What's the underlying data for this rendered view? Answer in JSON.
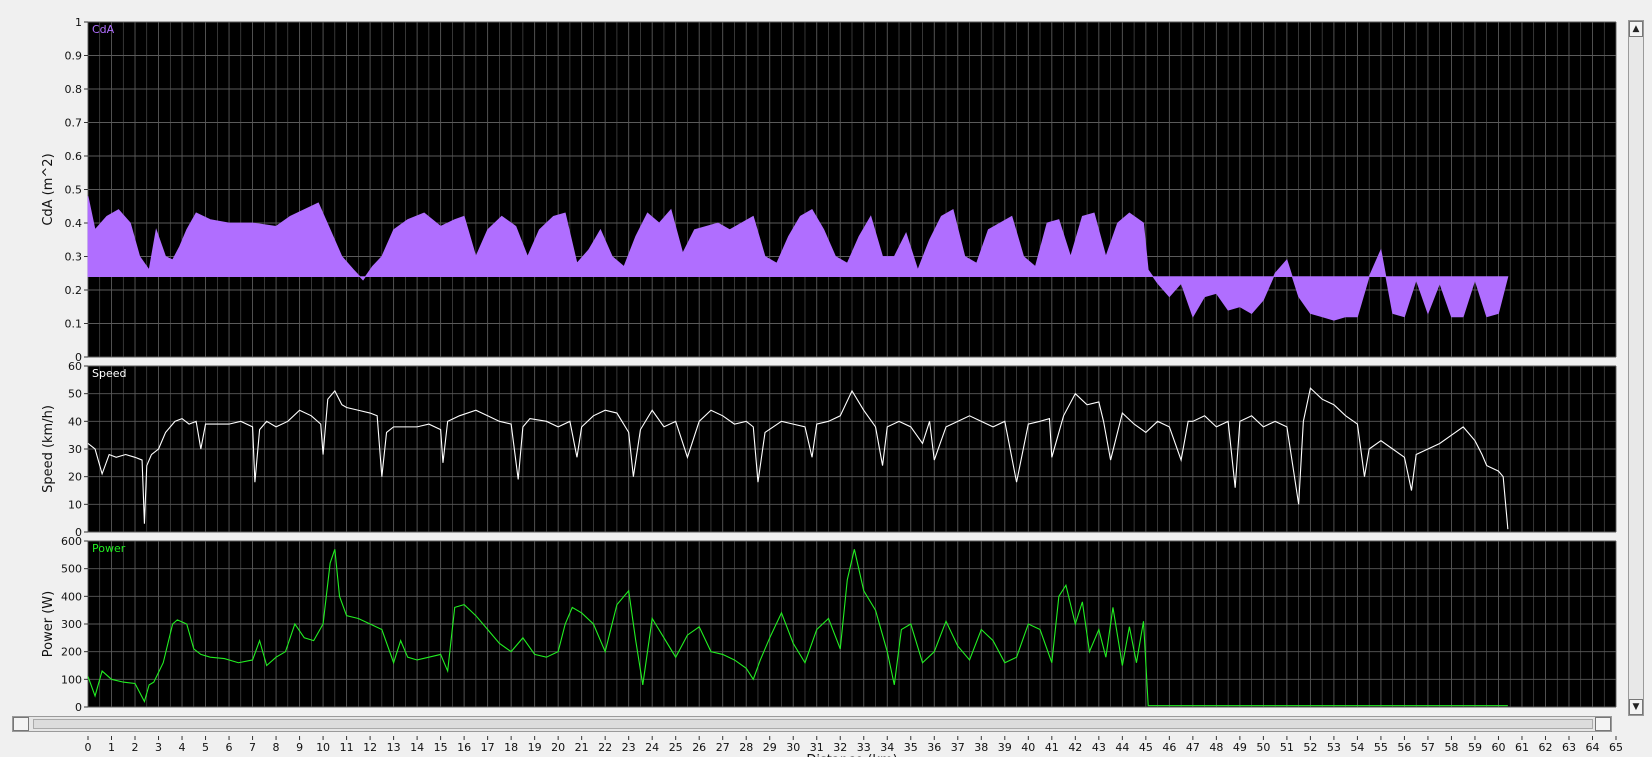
{
  "chart_data": [
    {
      "type": "area",
      "title": "CdA",
      "ylabel": "CdA (m^2)",
      "xlabel": "Distance (km)",
      "ylim": [
        0,
        1
      ],
      "yticks": [
        "0",
        "0.1",
        "0.2",
        "0.3",
        "0.4",
        "0.5",
        "0.6",
        "0.7",
        "0.8",
        "0.9",
        "1"
      ],
      "baseline": 0.24,
      "series": [
        {
          "name": "CdA",
          "color": "#b06eff",
          "x": [
            0,
            0.3,
            0.8,
            1.3,
            1.8,
            2.2,
            2.6,
            2.9,
            3.3,
            3.6,
            3.9,
            4.2,
            4.6,
            5.2,
            6,
            7,
            8,
            8.6,
            9.2,
            9.8,
            10.3,
            10.8,
            11.3,
            11.7,
            12.1,
            12.5,
            13,
            13.6,
            14.3,
            15,
            15.6,
            16,
            16.5,
            17,
            17.6,
            18.2,
            18.7,
            19.2,
            19.8,
            20.3,
            20.8,
            21.3,
            21.8,
            22.3,
            22.8,
            23.3,
            23.8,
            24.3,
            24.8,
            25.3,
            25.8,
            26.3,
            26.8,
            27.3,
            27.8,
            28.3,
            28.8,
            29.3,
            29.8,
            30.3,
            30.8,
            31.3,
            31.8,
            32.3,
            32.8,
            33.3,
            33.8,
            34.3,
            34.8,
            35.3,
            35.8,
            36.3,
            36.8,
            37.3,
            37.8,
            38.3,
            38.8,
            39.3,
            39.8,
            40.3,
            40.8,
            41.3,
            41.8,
            42.3,
            42.8,
            43.3,
            43.8,
            44.3,
            44.9,
            45.1,
            45.5,
            46,
            46.5,
            47,
            47.5,
            48,
            48.5,
            49,
            49.5,
            50,
            50.5,
            51,
            51.5,
            52,
            52.5,
            53,
            53.5,
            54,
            54.5,
            55,
            55.5,
            56,
            56.5,
            57,
            57.5,
            58,
            58.5,
            59,
            59.5,
            60,
            60.4
          ],
          "values": [
            0.48,
            0.38,
            0.42,
            0.44,
            0.4,
            0.3,
            0.26,
            0.38,
            0.3,
            0.29,
            0.33,
            0.38,
            0.43,
            0.41,
            0.4,
            0.4,
            0.39,
            0.42,
            0.44,
            0.46,
            0.38,
            0.3,
            0.26,
            0.23,
            0.27,
            0.3,
            0.38,
            0.41,
            0.43,
            0.39,
            0.41,
            0.42,
            0.3,
            0.38,
            0.42,
            0.39,
            0.3,
            0.38,
            0.42,
            0.43,
            0.28,
            0.32,
            0.38,
            0.3,
            0.27,
            0.36,
            0.43,
            0.4,
            0.44,
            0.31,
            0.38,
            0.39,
            0.4,
            0.38,
            0.4,
            0.42,
            0.3,
            0.28,
            0.36,
            0.42,
            0.44,
            0.38,
            0.3,
            0.28,
            0.36,
            0.42,
            0.3,
            0.3,
            0.37,
            0.26,
            0.35,
            0.42,
            0.44,
            0.3,
            0.28,
            0.38,
            0.4,
            0.42,
            0.3,
            0.27,
            0.4,
            0.41,
            0.3,
            0.42,
            0.43,
            0.3,
            0.4,
            0.43,
            0.4,
            0.26,
            0.22,
            0.18,
            0.22,
            0.12,
            0.18,
            0.19,
            0.14,
            0.15,
            0.13,
            0.17,
            0.25,
            0.29,
            0.18,
            0.13,
            0.12,
            0.11,
            0.12,
            0.12,
            0.24,
            0.32,
            0.13,
            0.12,
            0.23,
            0.13,
            0.22,
            0.12,
            0.12,
            0.23,
            0.12,
            0.13,
            0.24
          ]
        }
      ],
      "grid": true,
      "background": "#000000"
    },
    {
      "type": "line",
      "title": "Speed",
      "ylabel": "Speed (km/h)",
      "xlabel": "Distance (km)",
      "ylim": [
        0,
        60
      ],
      "yticks": [
        "0",
        "10",
        "20",
        "30",
        "40",
        "50",
        "60"
      ],
      "series": [
        {
          "name": "Speed",
          "color": "#ffffff",
          "x": [
            0,
            0.3,
            0.6,
            0.9,
            1.2,
            1.6,
            2,
            2.3,
            2.4,
            2.5,
            2.7,
            3,
            3.3,
            3.7,
            4,
            4.3,
            4.6,
            4.8,
            5,
            5.4,
            6,
            6.5,
            7,
            7.1,
            7.3,
            7.6,
            8,
            8.5,
            9,
            9.5,
            9.9,
            10,
            10.2,
            10.5,
            10.8,
            11,
            11.5,
            12,
            12.3,
            12.5,
            12.7,
            13,
            13.5,
            14,
            14.5,
            15,
            15.1,
            15.3,
            15.8,
            16.5,
            17,
            17.5,
            18,
            18.3,
            18.5,
            18.8,
            19.5,
            20,
            20.5,
            20.8,
            21,
            21.5,
            22,
            22.5,
            23,
            23.2,
            23.5,
            24,
            24.5,
            25,
            25.5,
            26,
            26.5,
            27,
            27.5,
            28,
            28.3,
            28.5,
            28.8,
            29.5,
            30,
            30.5,
            30.8,
            31,
            31.5,
            32,
            32.5,
            33,
            33.5,
            33.8,
            34,
            34.5,
            35,
            35.5,
            35.8,
            36,
            36.5,
            37,
            37.5,
            38,
            38.5,
            39,
            39.5,
            40,
            40.5,
            40.9,
            41,
            41.5,
            42,
            42.5,
            43,
            43.2,
            43.5,
            44,
            44.5,
            45,
            45.5,
            46,
            46.5,
            46.8,
            47,
            47.5,
            48,
            48.5,
            48.8,
            49,
            49.5,
            50,
            50.5,
            51,
            51.5,
            51.7,
            52,
            52.5,
            53,
            53.5,
            54,
            54.3,
            54.5,
            55,
            55.5,
            56,
            56.3,
            56.5,
            57,
            57.5,
            58,
            58.5,
            59,
            59.3,
            59.5,
            60,
            60.2,
            60.4
          ],
          "values": [
            32,
            30,
            21,
            28,
            27,
            28,
            27,
            26,
            3,
            24,
            28,
            30,
            36,
            40,
            41,
            39,
            40,
            30,
            39,
            39,
            39,
            40,
            38,
            18,
            37,
            40,
            38,
            40,
            44,
            42,
            39,
            28,
            48,
            51,
            46,
            45,
            44,
            43,
            42,
            20,
            36,
            38,
            38,
            38,
            39,
            37,
            25,
            40,
            42,
            44,
            42,
            40,
            39,
            19,
            38,
            41,
            40,
            38,
            40,
            27,
            38,
            42,
            44,
            43,
            36,
            20,
            37,
            44,
            38,
            40,
            27,
            40,
            44,
            42,
            39,
            40,
            38,
            18,
            36,
            40,
            39,
            38,
            27,
            39,
            40,
            42,
            51,
            44,
            38,
            24,
            38,
            40,
            38,
            32,
            40,
            26,
            38,
            40,
            42,
            40,
            38,
            40,
            18,
            39,
            40,
            41,
            27,
            42,
            50,
            46,
            47,
            40,
            26,
            43,
            39,
            36,
            40,
            38,
            26,
            40,
            40,
            42,
            38,
            40,
            16,
            40,
            42,
            38,
            40,
            38,
            10,
            40,
            52,
            48,
            46,
            42,
            39,
            20,
            30,
            33,
            30,
            27,
            15,
            28,
            30,
            32,
            35,
            38,
            33,
            28,
            24,
            22,
            20,
            1
          ]
        }
      ],
      "grid": true,
      "background": "#000000"
    },
    {
      "type": "line",
      "title": "Power",
      "ylabel": "Power (W)",
      "xlabel": "Distance (km)",
      "ylim": [
        0,
        600
      ],
      "yticks": [
        "0",
        "100",
        "200",
        "300",
        "400",
        "500",
        "600"
      ],
      "series": [
        {
          "name": "Power",
          "color": "#22ee22",
          "x": [
            0,
            0.3,
            0.6,
            1,
            1.5,
            2,
            2.4,
            2.6,
            2.8,
            3.2,
            3.6,
            3.8,
            4.2,
            4.5,
            4.8,
            5.2,
            5.8,
            6.4,
            7,
            7.3,
            7.6,
            8,
            8.4,
            8.8,
            9.2,
            9.6,
            10,
            10.3,
            10.5,
            10.7,
            11,
            11.5,
            12,
            12.5,
            13,
            13.3,
            13.6,
            14,
            14.5,
            15,
            15.3,
            15.6,
            16,
            16.5,
            17,
            17.5,
            18,
            18.5,
            19,
            19.5,
            20,
            20.3,
            20.6,
            21,
            21.5,
            22,
            22.5,
            23,
            23.3,
            23.6,
            24,
            24.5,
            25,
            25.5,
            26,
            26.5,
            27,
            27.5,
            28,
            28.3,
            28.6,
            29,
            29.5,
            30,
            30.5,
            31,
            31.5,
            32,
            32.3,
            32.6,
            33,
            33.5,
            34,
            34.3,
            34.6,
            35,
            35.5,
            36,
            36.5,
            37,
            37.5,
            38,
            38.5,
            39,
            39.5,
            40,
            40.5,
            41,
            41.3,
            41.6,
            42,
            42.3,
            42.6,
            43,
            43.3,
            43.6,
            44,
            44.3,
            44.6,
            44.9,
            45.1,
            46,
            48,
            50,
            52,
            54,
            56,
            58,
            60,
            60.4
          ],
          "values": [
            110,
            40,
            130,
            100,
            90,
            85,
            20,
            80,
            90,
            160,
            300,
            315,
            300,
            210,
            190,
            180,
            175,
            160,
            170,
            240,
            150,
            180,
            200,
            300,
            250,
            240,
            300,
            520,
            570,
            400,
            330,
            320,
            300,
            280,
            160,
            240,
            180,
            170,
            180,
            190,
            130,
            360,
            370,
            330,
            280,
            230,
            200,
            250,
            190,
            180,
            200,
            300,
            360,
            340,
            300,
            200,
            370,
            420,
            240,
            80,
            320,
            250,
            180,
            260,
            290,
            200,
            190,
            170,
            140,
            100,
            170,
            250,
            340,
            230,
            160,
            280,
            320,
            210,
            460,
            570,
            420,
            350,
            200,
            80,
            280,
            300,
            160,
            200,
            310,
            220,
            170,
            280,
            240,
            160,
            180,
            300,
            280,
            160,
            400,
            440,
            300,
            380,
            200,
            280,
            180,
            360,
            150,
            290,
            160,
            310,
            5,
            5,
            5,
            5,
            5,
            5,
            5,
            5,
            5,
            5
          ]
        }
      ],
      "grid": true,
      "background": "#000000"
    }
  ],
  "x_axis": {
    "label": "Distance (km)",
    "min": 0,
    "max": 65,
    "ticks": [
      "0",
      "1",
      "2",
      "3",
      "4",
      "5",
      "6",
      "7",
      "8",
      "9",
      "10",
      "11",
      "12",
      "13",
      "14",
      "15",
      "16",
      "17",
      "18",
      "19",
      "20",
      "21",
      "22",
      "23",
      "24",
      "25",
      "26",
      "27",
      "28",
      "29",
      "30",
      "31",
      "32",
      "33",
      "34",
      "35",
      "36",
      "37",
      "38",
      "39",
      "40",
      "41",
      "42",
      "43",
      "44",
      "45",
      "46",
      "47",
      "48",
      "49",
      "50",
      "51",
      "52",
      "53",
      "54",
      "55",
      "56",
      "57",
      "58",
      "59",
      "60",
      "61",
      "62",
      "63",
      "64",
      "65"
    ]
  },
  "colors": {
    "plot_background": "#000000",
    "grid": "#5a5a5a",
    "frame": "#f0f0f0"
  },
  "scrollbar_icons": {
    "up": "up-arrow-icon",
    "down": "down-arrow-icon"
  }
}
